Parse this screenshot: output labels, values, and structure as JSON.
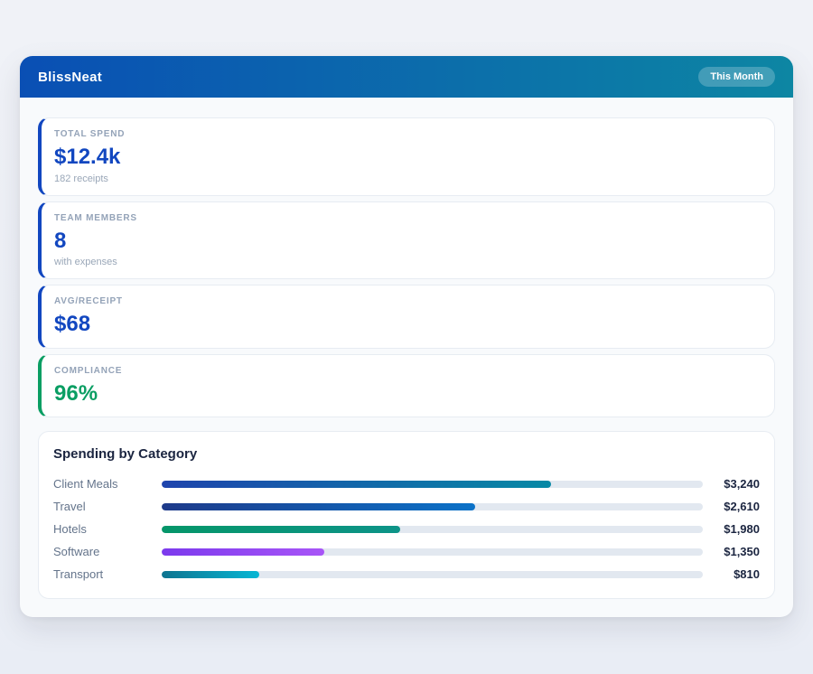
{
  "app": {
    "title": "BlissNeat",
    "badge_label": "This Month"
  },
  "theme": {
    "header_gradient": [
      "#0a4fb4",
      "#0d86a3"
    ],
    "page_background": "#eceff6",
    "card_background": "#ffffff",
    "track_color": "#e2e8f0",
    "label_gray": "#94a3b8",
    "text_dark": "#1b2540"
  },
  "stats": [
    {
      "label": "TOTAL SPEND",
      "value": "$12.4k",
      "sub": "182 receipts",
      "accent": "#1247c0",
      "value_color": "#1247c0"
    },
    {
      "label": "TEAM MEMBERS",
      "value": "8",
      "sub": "with expenses",
      "accent": "#1247c0",
      "value_color": "#1247c0"
    },
    {
      "label": "AVG/RECEIPT",
      "value": "$68",
      "sub": "",
      "accent": "#1247c0",
      "value_color": "#1247c0"
    },
    {
      "label": "COMPLIANCE",
      "value": "96%",
      "sub": "",
      "accent": "#0a9e63",
      "value_color": "#0a9e63"
    }
  ],
  "chart_data": {
    "type": "bar",
    "orientation": "horizontal",
    "title": "Spending by Category",
    "categories": [
      "Client Meals",
      "Travel",
      "Hotels",
      "Software",
      "Transport"
    ],
    "values": [
      3240,
      2610,
      1980,
      1350,
      810
    ],
    "value_labels": [
      "$3,240",
      "$2,610",
      "$1,980",
      "$1,350",
      "$810"
    ],
    "max_scale": 4500,
    "bar_colors": [
      [
        "#1e44ad",
        "#0789a5"
      ],
      [
        "#1e3a8a",
        "#0b72c8"
      ],
      [
        "#059669",
        "#0d9488"
      ],
      [
        "#7c3aed",
        "#a855f7"
      ],
      [
        "#0e7490",
        "#06b6d4"
      ]
    ]
  }
}
